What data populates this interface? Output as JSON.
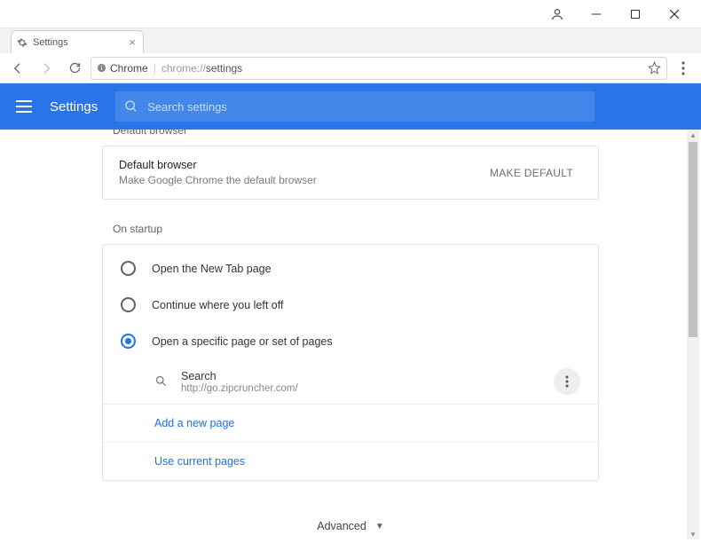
{
  "window": {
    "tab_title": "Settings"
  },
  "omnibox": {
    "secure_label": "Chrome",
    "url_host": "chrome://",
    "url_path": "settings"
  },
  "header": {
    "title": "Settings",
    "search_placeholder": "Search settings"
  },
  "sections": {
    "default_browser_label": "Default browser",
    "on_startup_label": "On startup"
  },
  "default_browser": {
    "heading": "Default browser",
    "sub": "Make Google Chrome the default browser",
    "button": "MAKE DEFAULT"
  },
  "startup": {
    "options": [
      "Open the New Tab page",
      "Continue where you left off",
      "Open a specific page or set of pages"
    ],
    "selected_index": 2,
    "page": {
      "title": "Search",
      "url": "http://go.zipcruncher.com/"
    },
    "add_page": "Add a new page",
    "use_current": "Use current pages"
  },
  "advanced_label": "Advanced"
}
